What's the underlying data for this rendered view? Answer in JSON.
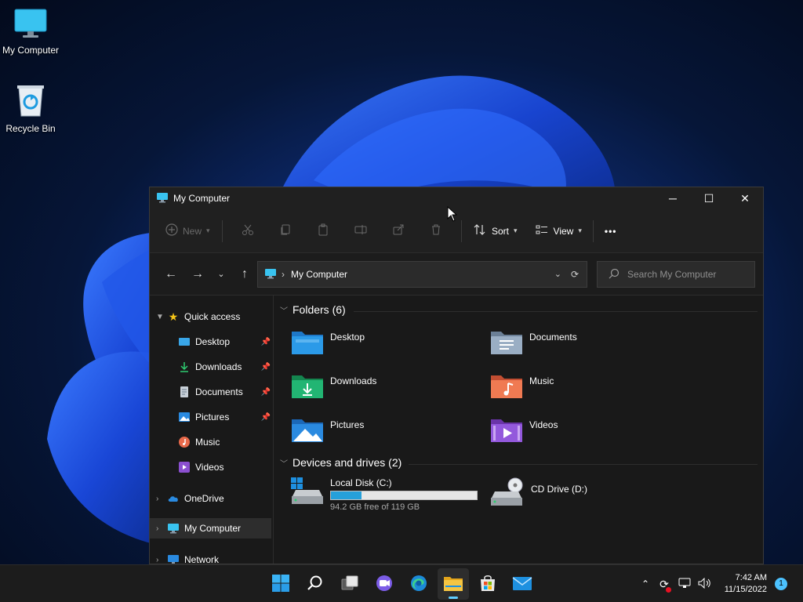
{
  "desktop": {
    "icons": [
      {
        "label": "My Computer",
        "icon": "monitor-icon"
      },
      {
        "label": "Recycle Bin",
        "icon": "recycle-bin-icon"
      }
    ]
  },
  "window": {
    "title": "My Computer",
    "controls": {
      "minimize": "─",
      "maximize": "☐",
      "close": "✕"
    }
  },
  "toolbar": {
    "new_label": "New",
    "sort_label": "Sort",
    "view_label": "View",
    "more_label": "•••"
  },
  "address": {
    "crumb": "My Computer",
    "search_placeholder": "Search My Computer"
  },
  "nav": {
    "quick_access": "Quick access",
    "items": [
      {
        "label": "Desktop",
        "icon": "desktop-folder-icon",
        "pinned": true
      },
      {
        "label": "Downloads",
        "icon": "download-icon",
        "pinned": true
      },
      {
        "label": "Documents",
        "icon": "documents-icon",
        "pinned": true
      },
      {
        "label": "Pictures",
        "icon": "pictures-icon",
        "pinned": true
      },
      {
        "label": "Music",
        "icon": "music-icon",
        "pinned": false
      },
      {
        "label": "Videos",
        "icon": "videos-icon",
        "pinned": false
      }
    ],
    "onedrive": "OneDrive",
    "my_computer": "My Computer",
    "network": "Network"
  },
  "content": {
    "folders_header": "Folders (6)",
    "folders": [
      {
        "label": "Desktop",
        "icon": "desktop-folder-icon",
        "color": "#1e90e0"
      },
      {
        "label": "Documents",
        "icon": "documents-folder-icon",
        "color": "#8ea3bd"
      },
      {
        "label": "Downloads",
        "icon": "downloads-folder-icon",
        "color": "#1fae6c"
      },
      {
        "label": "Music",
        "icon": "music-folder-icon",
        "color": "#e8694a"
      },
      {
        "label": "Pictures",
        "icon": "pictures-folder-icon",
        "color": "#2a8ae0"
      },
      {
        "label": "Videos",
        "icon": "videos-folder-icon",
        "color": "#8b4fd0"
      }
    ],
    "drives_header": "Devices and drives (2)",
    "drives": [
      {
        "label": "Local Disk (C:)",
        "free_text": "94.2 GB free of 119 GB",
        "used_fraction": 0.21,
        "icon": "hard-drive-icon"
      },
      {
        "label": "CD Drive (D:)",
        "icon": "cd-drive-icon"
      }
    ]
  },
  "taskbar": {
    "time": "7:42 AM",
    "date": "11/15/2022",
    "notifications": "1"
  },
  "colors": {
    "accent": "#60cdff",
    "drive_fill": "#26a0da"
  }
}
